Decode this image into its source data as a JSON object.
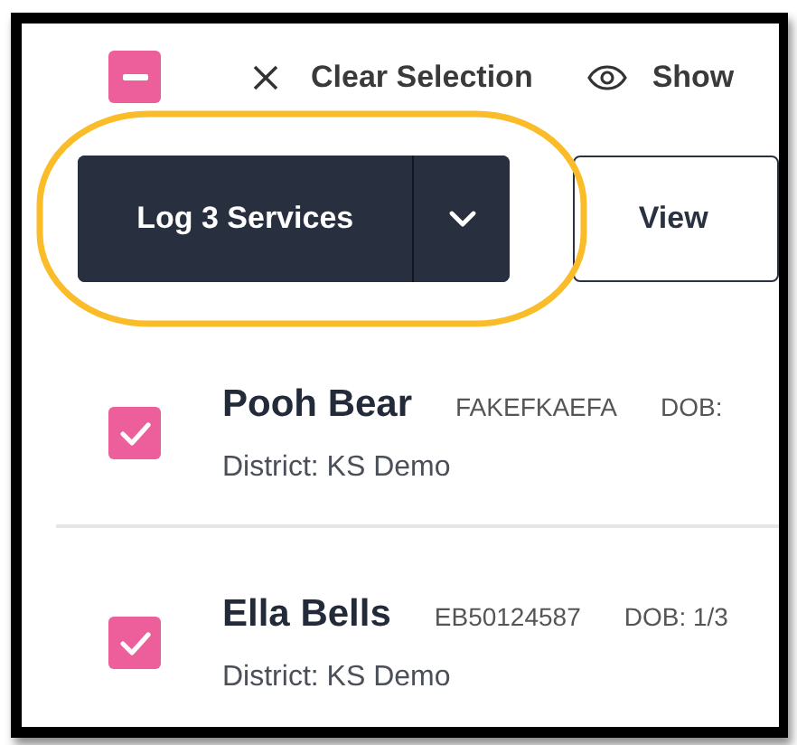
{
  "toolbar": {
    "select_all": {
      "indeterminate": true
    },
    "clear_selection": "Clear Selection",
    "show": "Show"
  },
  "actions": {
    "primary": "Log 3 Services",
    "secondary": "View"
  },
  "students": [
    {
      "name": "Pooh Bear",
      "id": "FAKEFKAEFA",
      "dob": "DOB:",
      "district_label": "District:",
      "district": "KS Demo",
      "selected": true
    },
    {
      "name": "Ella Bells",
      "id": "EB50124587",
      "dob": "DOB: 1/3",
      "district_label": "District:",
      "district": "KS Demo",
      "selected": true
    }
  ]
}
